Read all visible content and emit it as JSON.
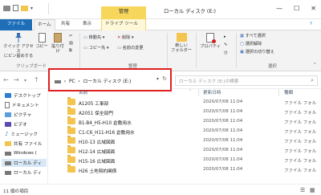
{
  "titlebar": {
    "context_tab_header": "管理",
    "window_title": "ローカル ディスク (E:)",
    "minimize": "—",
    "maximize": "☐",
    "close": "✕"
  },
  "tabs": {
    "file": "ファイル",
    "home": "ホーム",
    "share": "共有",
    "view": "表示",
    "drive_tools": "ドライブ ツール",
    "help_icon": "?"
  },
  "ribbon": {
    "pin": "クイック アクセス\nにピン留めする",
    "copy": "コピー",
    "paste": "貼り付け",
    "clipboard_group": "クリップボード",
    "move_to": "移動先",
    "delete": "削除",
    "copy_to": "コピー先",
    "rename": "名前の変更",
    "organize_group": "整理",
    "new_folder": "新しい\nフォルダー",
    "properties": "プロパティ",
    "select_all": "すべて選択",
    "select_none": "選択解除",
    "invert_selection": "選択の切り替え",
    "select_group": "選択"
  },
  "address": {
    "back": "←",
    "forward": "→",
    "up": "↑",
    "pc": "PC",
    "drive": "ローカル ディスク (E:)",
    "sep": "›",
    "refresh": "↻",
    "search_placeholder": "ローカル ディスク (E:)の検索"
  },
  "nav": {
    "items": [
      {
        "label": "デスクトップ",
        "icon": "desktop-icon"
      },
      {
        "label": "ドキュメント",
        "icon": "documents-icon"
      },
      {
        "label": "ピクチャ",
        "icon": "pictures-icon"
      },
      {
        "label": "ビデオ",
        "icon": "videos-icon"
      },
      {
        "label": "ミュージック",
        "icon": "music-icon"
      },
      {
        "label": "共有 ファイル",
        "icon": "shared-folder-icon"
      },
      {
        "label": "Windows (",
        "icon": "drive-icon"
      },
      {
        "label": "ローカル ディ",
        "icon": "drive-icon"
      },
      {
        "label": "ローカル ディ",
        "icon": "drive-icon"
      }
    ]
  },
  "columns": {
    "name": "名前",
    "date": "更新日時",
    "type": "種類"
  },
  "files": [
    {
      "name": "A1205 工事部",
      "date": "2020/07/08 11:04",
      "type": "ファイル フォル"
    },
    {
      "name": "A2051 保全部門",
      "date": "2020/07/08 11:04",
      "type": "ファイル フォル"
    },
    {
      "name": "B1-B4_H5-H10 倉敷用水",
      "date": "2020/07/08 11:04",
      "type": "ファイル フォル"
    },
    {
      "name": "C1-C6_H11-H16 倉敷用水",
      "date": "2020/07/08 11:04",
      "type": "ファイル フォル"
    },
    {
      "name": "H10-13 広域図面",
      "date": "2020/07/08 11:04",
      "type": "ファイル フォル"
    },
    {
      "name": "H12-14 広域図面",
      "date": "2020/07/08 11:04",
      "type": "ファイル フォル"
    },
    {
      "name": "H15-16 広域図面",
      "date": "2020/07/08 11:04",
      "type": "ファイル フォル"
    },
    {
      "name": "H26 土地契約関係",
      "date": "2020/07/08 11:04",
      "type": "ファイル フォル"
    }
  ],
  "status": {
    "item_count": "11 個の項目"
  },
  "colors": {
    "file_tab": "#1e6fb8",
    "context_tab": "#f6d75b",
    "highlight_box": "#e01f1f",
    "folder": "#f3c44e"
  }
}
